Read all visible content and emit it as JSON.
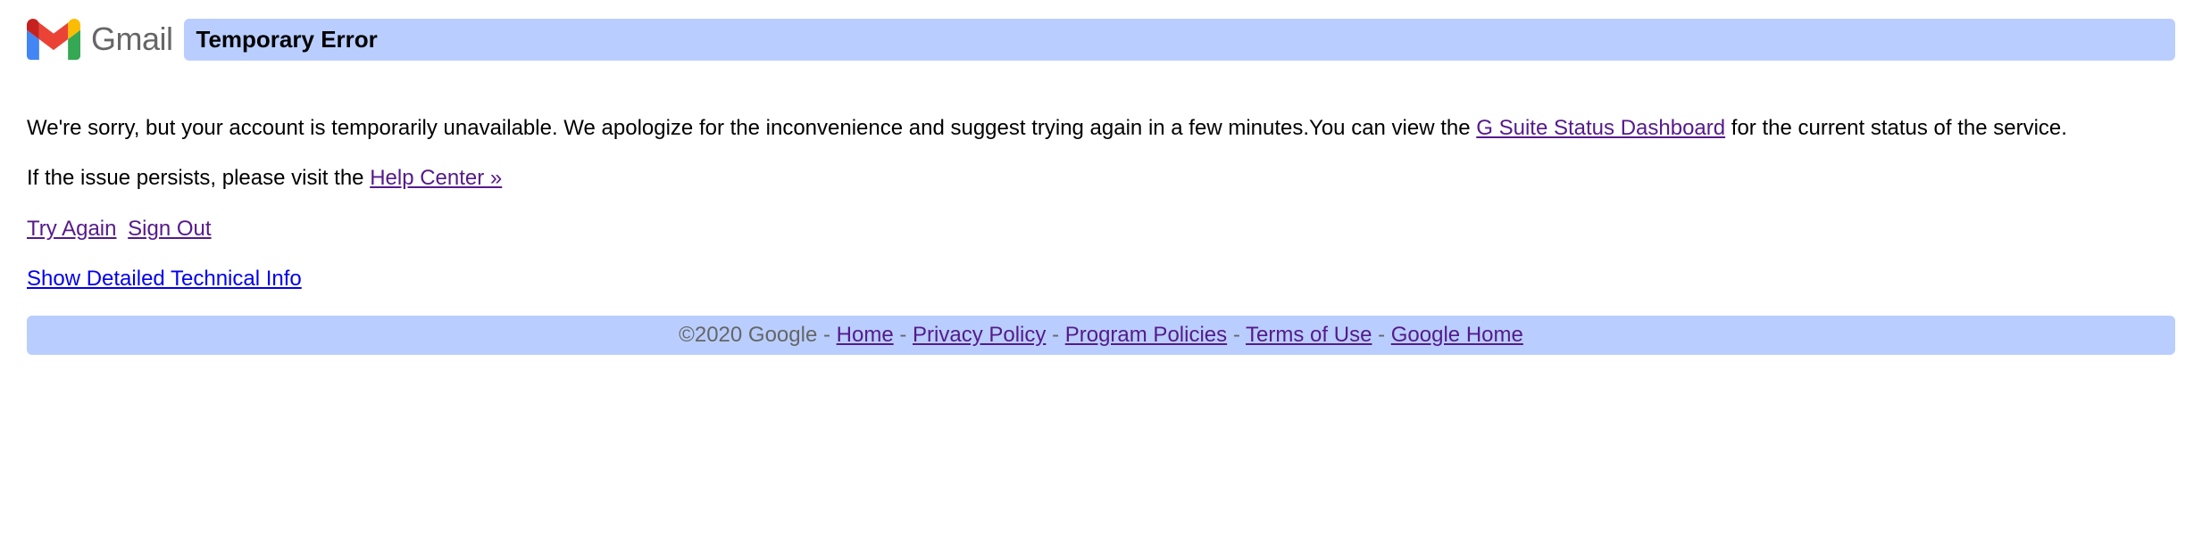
{
  "header": {
    "brand_text": "Gmail",
    "error_title": "Temporary Error"
  },
  "content": {
    "apology_prefix": "We're sorry, but your account is temporarily unavailable. We apologize for the inconvenience and suggest trying again in a few minutes.You can view the ",
    "status_link": "G Suite Status Dashboard",
    "apology_suffix": " for the current status of the service.",
    "persist_prefix": "If the issue persists, please visit the ",
    "help_center_link": "Help Center »",
    "try_again": "Try Again",
    "sign_out": "Sign Out",
    "tech_info": "Show Detailed Technical Info"
  },
  "footer": {
    "copyright": "©2020 Google",
    "home": "Home",
    "privacy": "Privacy Policy",
    "program": "Program Policies",
    "terms": "Terms of Use",
    "google_home": "Google Home"
  }
}
